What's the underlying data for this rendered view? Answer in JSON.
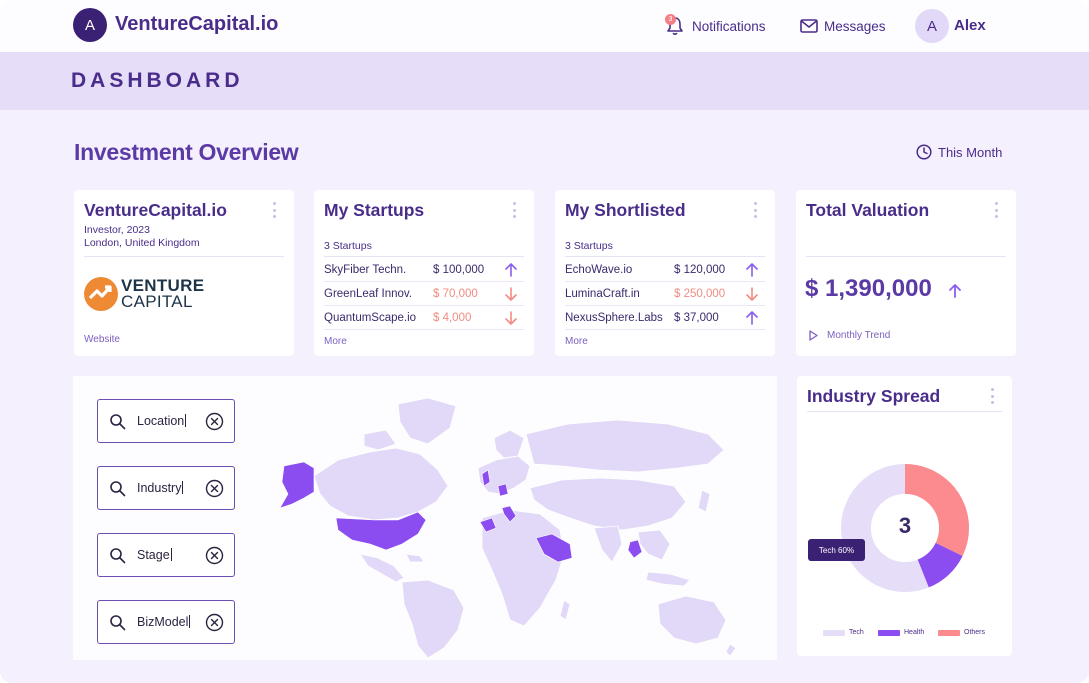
{
  "header": {
    "logo_letter": "A",
    "app_name": "VentureCapital.io",
    "notifications_label": "Notifications",
    "notifications_count": "3",
    "messages_label": "Messages",
    "user_initial": "A",
    "user_name": "Alex"
  },
  "page": {
    "title": "DASHBOARD",
    "section_title": "Investment Overview",
    "period_label": "This Month"
  },
  "profile_card": {
    "title": "VentureCapital.io",
    "subtitle": "Investor, 2023",
    "location": "London, United Kingdom",
    "logo_line1": "VENTURE",
    "logo_line2": "CAPITAL",
    "website_label": "Website"
  },
  "startups_card": {
    "title": "My Startups",
    "count_label": "3 Startups",
    "rows": [
      {
        "name": "SkyFiber Techn.",
        "value": "$ 100,000",
        "trend": "up"
      },
      {
        "name": "GreenLeaf Innov.",
        "value": "$ 70,000",
        "trend": "down"
      },
      {
        "name": "QuantumScape.io",
        "value": "$ 4,000",
        "trend": "down"
      }
    ],
    "more_label": "More"
  },
  "shortlisted_card": {
    "title": "My Shortlisted",
    "count_label": "3 Startups",
    "rows": [
      {
        "name": "EchoWave.io",
        "value": "$ 120,000",
        "trend": "up"
      },
      {
        "name": "LuminaCraft.in",
        "value": "$ 250,000",
        "trend": "down"
      },
      {
        "name": "NexusSphere.Labs",
        "value": "$ 37,000",
        "trend": "up"
      }
    ],
    "more_label": "More"
  },
  "valuation_card": {
    "title": "Total Valuation",
    "value": "$ 1,390,000",
    "trend": "up",
    "trend_link": "Monthly Trend"
  },
  "filters": [
    {
      "label": "Location"
    },
    {
      "label": "Industry"
    },
    {
      "label": "Stage"
    },
    {
      "label": "BizModel"
    }
  ],
  "industry_card": {
    "title": "Industry Spread",
    "center_value": "3",
    "tooltip": "Tech 60%",
    "legend": [
      {
        "label": "Tech",
        "color": "#e6def8"
      },
      {
        "label": "Health",
        "color": "#8b4cf0"
      },
      {
        "label": "Others",
        "color": "#fb8b8f"
      }
    ]
  },
  "colors": {
    "primary": "#4a2d8a",
    "accent": "#8b4cf0",
    "map_land": "#e2d9f8",
    "map_highlight": "#8b4cf0",
    "negative": "#f28b82"
  }
}
